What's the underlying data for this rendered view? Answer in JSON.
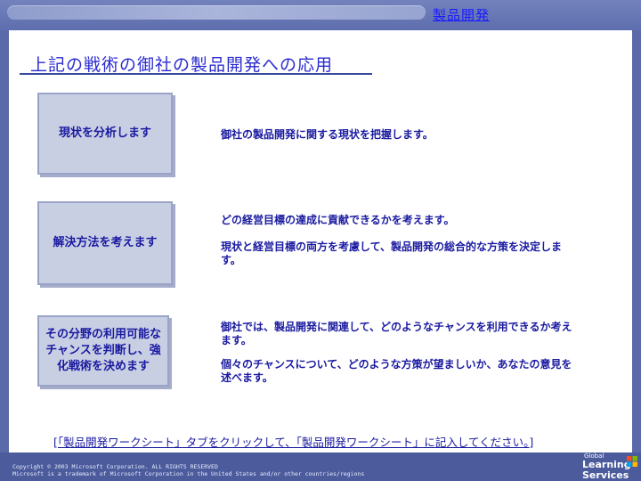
{
  "header": {
    "section_title": "製品開発"
  },
  "slide": {
    "title": "上記の戦術の御社の製品開発への応用",
    "steps": [
      {
        "label": "現状を分析します"
      },
      {
        "label": "解決方法を考えます"
      },
      {
        "label": "その分野の利用可能なチャンスを判断し、強化戦術を決めます"
      }
    ],
    "descriptions": [
      "御社の製品開発に関する現状を把握します。",
      "どの経営目標の達成に貢献できるかを考えます。",
      "現状と経営目標の両方を考慮して、製品開発の総合的な方策を決定します。",
      "御社では、製品開発に関連して、どのようなチャンスを利用できるか考えます。",
      "個々のチャンスについて、どのような方策が望ましいか、あなたの意見を述べます。"
    ],
    "instruction": "[「製品開発ワークシート」タブをクリックして、「製品開発ワークシート」に記入してください。]"
  },
  "footer": {
    "copyright_line1": "Copyright © 2003 Microsoft Corporation. ALL RIGHTS RESERVED",
    "copyright_line2": "Microsoft is a trademark of Microsoft Corporation in the United States and/or other countries/regions",
    "logo_small": "Global",
    "logo_main": "Learning",
    "logo_sub": "Services"
  }
}
